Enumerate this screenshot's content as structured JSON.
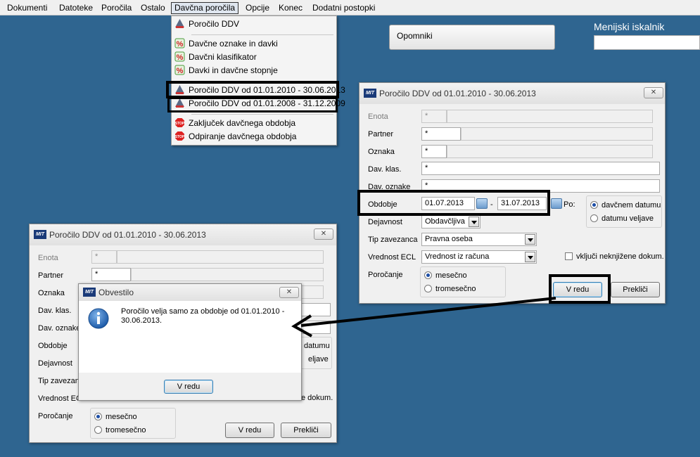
{
  "menubar": {
    "items": [
      "Dokumenti",
      "Datoteke",
      "Poročila",
      "Ostalo",
      "Davčna poročila",
      "Opcije",
      "Konec",
      "Dodatni postopki"
    ]
  },
  "dropdown": {
    "items": [
      {
        "label": "Poročilo DDV",
        "icon": "report-icon"
      },
      {
        "label": "Davčne oznake in davki",
        "icon": "percent-icon"
      },
      {
        "label": "Davčni klasifikator",
        "icon": "percent-icon"
      },
      {
        "label": "Davki in davčne stopnje",
        "icon": "percent-icon"
      },
      {
        "label": "Poročilo DDV od 01.01.2010 - 30.06.2013",
        "icon": "report-icon"
      },
      {
        "label": "Poročilo DDV od 01.01.2008 - 31.12.2009",
        "icon": "report-icon"
      },
      {
        "label": "Zaključek davčnega obdobja",
        "icon": "stop-icon"
      },
      {
        "label": "Odpiranje davčnega obdobja",
        "icon": "stop-icon"
      }
    ]
  },
  "quick": {
    "button": "Opomniki",
    "search_title": "Menijski iskalnik",
    "search_value": ""
  },
  "dialog_main": {
    "logo": "MIT",
    "title": "Poročilo DDV od 01.01.2010 - 30.06.2013",
    "labels": {
      "enota": "Enota",
      "partner": "Partner",
      "oznaka": "Oznaka",
      "dav_klas": "Dav. klas.",
      "dav_oznake": "Dav. oznake",
      "obdobje": "Obdobje",
      "dejavnost": "Dejavnost",
      "tip": "Tip zavezanca",
      "vrednost": "Vrednost ECL",
      "porocanje": "Poročanje"
    },
    "values": {
      "enota": "*",
      "partner": "*",
      "oznaka": "*",
      "dav_klas": "*",
      "dav_oznake": "*",
      "date_from": "01.07.2013",
      "date_sep": "-",
      "date_to": "31.07.2013",
      "po_label": "Po:",
      "dejavnost": "Obdavčljiva",
      "tip": "Pravna oseba",
      "vrednost": "Vrednost iz računa"
    },
    "po_options": [
      "davčnem datumu",
      "datumu veljave"
    ],
    "porocanje_options": [
      "mesečno",
      "tromesečno"
    ],
    "checkbox": "vključi neknjižene dokum.",
    "ok": "V redu",
    "cancel": "Prekliči"
  },
  "dialog_back": {
    "logo": "MIT",
    "title": "Poročilo DDV od 01.01.2010 - 30.06.2013",
    "labels": {
      "enota": "Enota",
      "partner": "Partner",
      "oznaka": "Oznaka",
      "dav_klas": "Dav. klas.",
      "dav_oznake": "Dav. oznake",
      "obdobje": "Obdobje",
      "dejavnost": "Dejavnost",
      "tip": "Tip zavezan",
      "vrednost": "Vrednost EC",
      "porocanje": "Poročanje"
    },
    "values": {
      "enota": "*",
      "partner": "*"
    },
    "partial": {
      "datumu": "datumu",
      "veljave": "eljave",
      "dokum": "e dokum."
    },
    "porocanje_options": [
      "mesečno",
      "tromesečno"
    ],
    "ok": "V redu",
    "cancel": "Prekliči"
  },
  "notice": {
    "title": "Obvestilo",
    "message": "Poročilo velja samo za obdobje od 01.01.2010 - 30.06.2013.",
    "ok": "V redu"
  },
  "colors": {
    "desktop": "#2f6590",
    "annotation": "#000000"
  }
}
